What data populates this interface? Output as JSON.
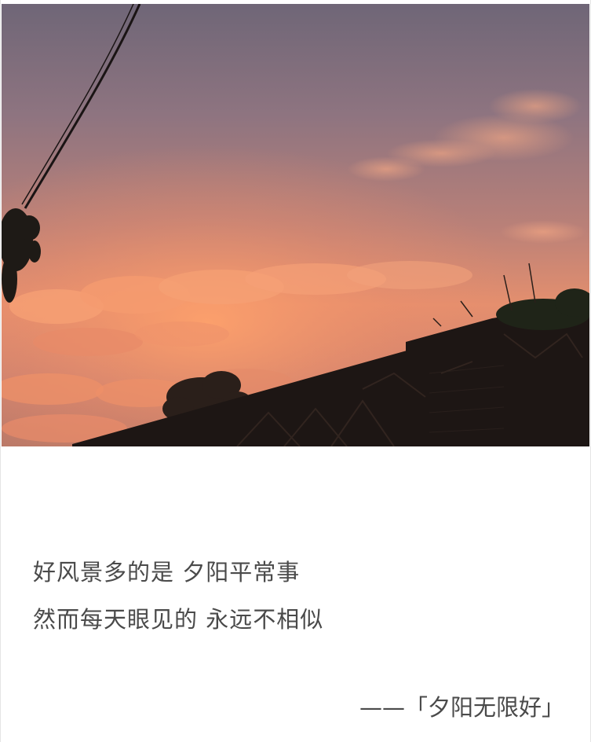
{
  "poem": {
    "line1": "好风景多的是 夕阳平常事",
    "line2": "然而每天眼见的 永远不相似"
  },
  "attribution": "——「夕阳无限好」",
  "colors": {
    "sky_top": "#776b7c",
    "sky_mid": "#b07c7c",
    "glow": "#f3946a",
    "silhouette": "#1d1614",
    "text": "#4a4a4a"
  }
}
